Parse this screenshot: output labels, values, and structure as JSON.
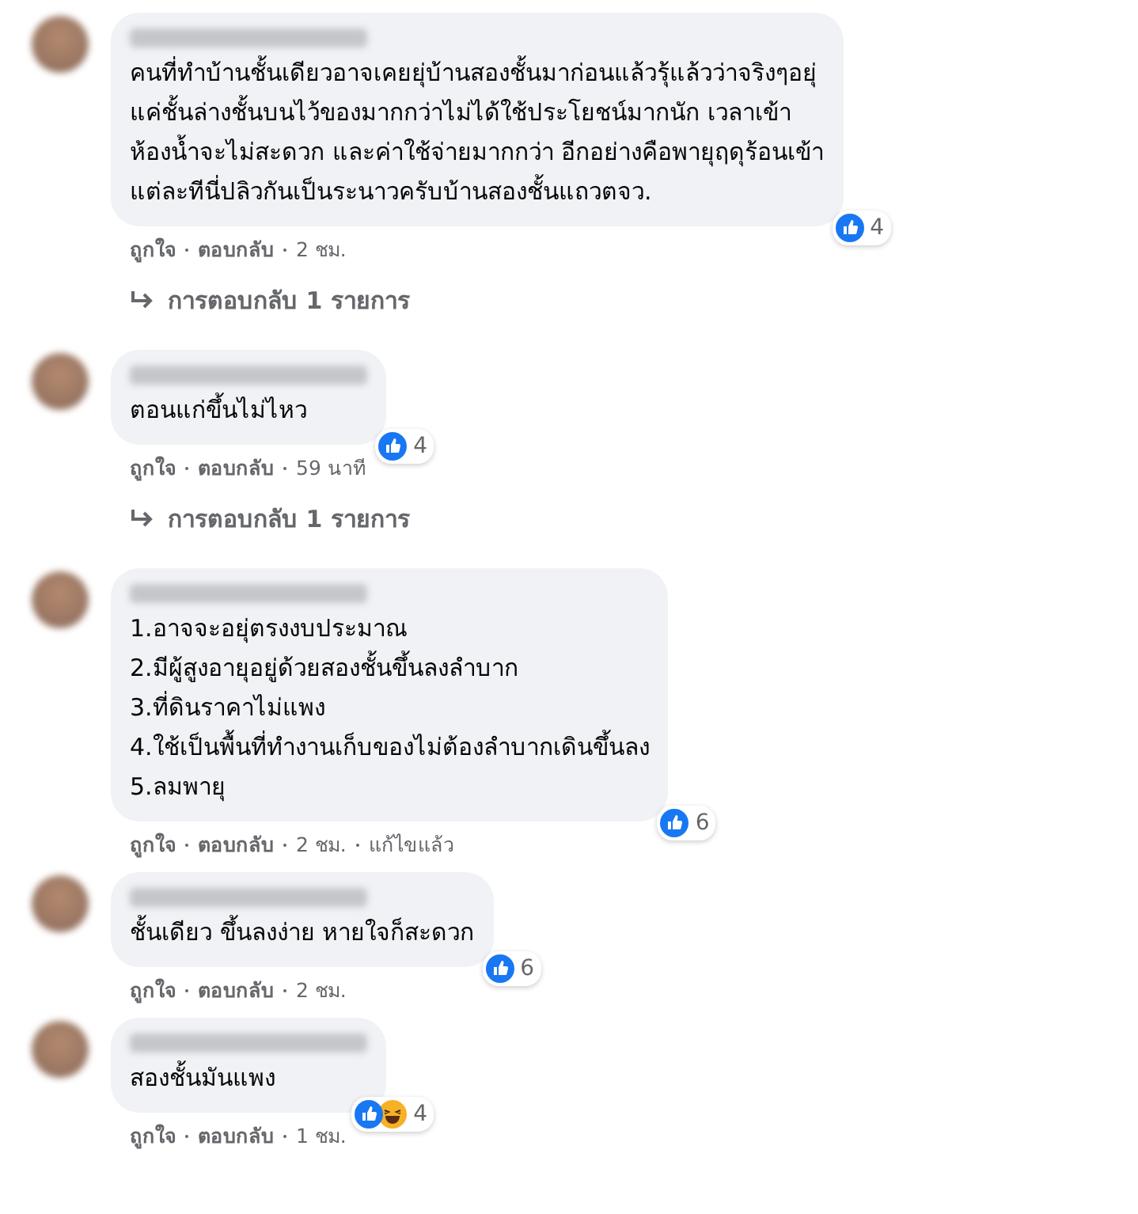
{
  "comments": [
    {
      "lines": [
        "คนที่ทำบ้านชั้นเดียวอาจเคยยุ่บ้านสองชั้นมาก่อนแล้วรุ้แล้วว่าจริงๆอยุ่",
        "แค่ชั้นล่างชั้นบนไว้ของมากกว่าไม่ได้ใช้ประโยชน์มากนัก เวลาเข้า",
        "ห้องน้ำจะไม่สะดวก และค่าใช้จ่ายมากกว่า อีกอย่างคือพายุฤดุร้อนเข้า",
        "แต่ละทีนี่ปลิวกันเป็นระนาวครับบ้านสองชั้นแถวตจว."
      ],
      "reactions": [
        {
          "kind": "like"
        }
      ],
      "reaction_count": "4",
      "actions": [
        "ถูกใจ",
        "ตอบกลับ",
        "2 ชม."
      ],
      "replies": "การตอบกลับ 1 รายการ"
    },
    {
      "lines": [
        "ตอนแก่ขึ้นไม่ไหว"
      ],
      "reactions": [
        {
          "kind": "like"
        }
      ],
      "reaction_count": "4",
      "actions": [
        "ถูกใจ",
        "ตอบกลับ",
        "59 นาที"
      ],
      "replies": "การตอบกลับ 1 รายการ"
    },
    {
      "lines": [
        "1.อาจจะอยุ่ตรงงบประมาณ",
        "2.มีผู้สูงอายุอยู่ด้วยสองชั้นขึ้นลงลำบาก",
        "3.ที่ดินราคาไม่แพง",
        "4.ใช้เป็นพื้นที่ทำงานเก็บของไม่ต้องลำบากเดินขึ้นลง",
        "5.ลมพายุ"
      ],
      "reactions": [
        {
          "kind": "like"
        }
      ],
      "reaction_count": "6",
      "actions": [
        "ถูกใจ",
        "ตอบกลับ",
        "2 ชม.",
        "แก้ไขแล้ว"
      ]
    },
    {
      "lines": [
        "ชั้นเดียว ขึ้นลงง่าย หายใจก็สะดวก"
      ],
      "reactions": [
        {
          "kind": "like"
        }
      ],
      "reaction_count": "6",
      "actions": [
        "ถูกใจ",
        "ตอบกลับ",
        "2 ชม."
      ]
    },
    {
      "lines": [
        "สองชั้นมันแพง"
      ],
      "reactions": [
        {
          "kind": "like"
        },
        {
          "kind": "haha"
        }
      ],
      "reaction_count": "4",
      "actions": [
        "ถูกใจ",
        "ตอบกลับ",
        "1 ชม."
      ]
    }
  ]
}
